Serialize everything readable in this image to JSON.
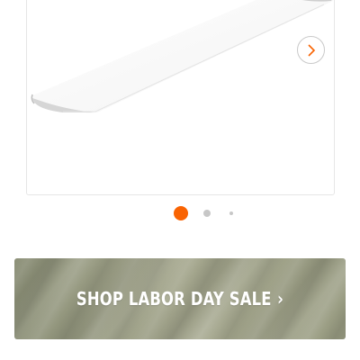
{
  "carousel": {
    "total_slides": 3,
    "active_slide": 1,
    "accent_color": "#f96302",
    "next_icon": "chevron-right-icon"
  },
  "banner": {
    "label": "SHOP LABOR DAY SALE",
    "chevron": "›"
  }
}
